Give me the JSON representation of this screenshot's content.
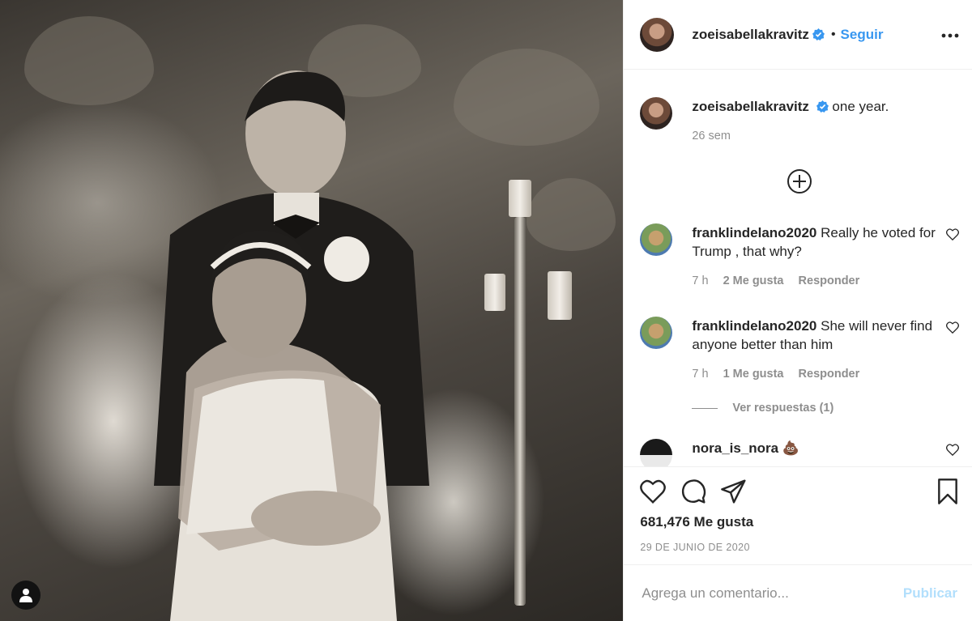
{
  "post": {
    "author": {
      "username": "zoeisabellakravitz",
      "verified": true,
      "follow_label": "Seguir",
      "separator": "•"
    },
    "caption": {
      "username": "zoeisabellakravitz",
      "text": "one year.",
      "time": "26 sem"
    },
    "comments": [
      {
        "username": "franklindelano2020",
        "text": "Really he voted for Trump , that why?",
        "time": "7 h",
        "likes": "2 Me gusta",
        "reply_label": "Responder"
      },
      {
        "username": "franklindelano2020",
        "text": "She will never find anyone better than him",
        "time": "7 h",
        "likes": "1 Me gusta",
        "reply_label": "Responder",
        "view_replies": "Ver respuestas (1)"
      },
      {
        "username": "nora_is_nora",
        "text": "💩",
        "time": "",
        "likes": "",
        "reply_label": ""
      }
    ],
    "likes_count": "681,476 Me gusta",
    "date": "29 DE JUNIO DE 2020",
    "comment_placeholder": "Agrega un comentario...",
    "publish_label": "Publicar"
  },
  "icons": {
    "verified": "verified-badge-icon",
    "more": "more-options-icon",
    "load_more": "plus-circle-icon",
    "like": "heart-icon",
    "comment": "comment-icon",
    "share": "share-icon",
    "save": "bookmark-icon",
    "tag": "user-tag-icon"
  },
  "colors": {
    "accent": "#3897f0",
    "text": "#262626",
    "muted": "#8e8e8e",
    "publish_disabled": "#b2dffc"
  }
}
